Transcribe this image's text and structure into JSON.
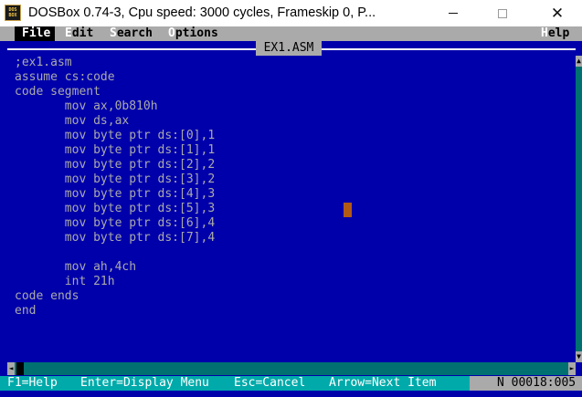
{
  "window": {
    "title": "DOSBox 0.74-3, Cpu speed:     3000 cycles, Frameskip  0, P...",
    "icon_top": "DOS",
    "icon_bottom": "BOX",
    "minimize_icon": "minimize-icon",
    "maximize_icon": "maximize-icon",
    "close_icon": "close-icon",
    "close_glyph": "✕"
  },
  "menubar": {
    "items": [
      {
        "hot": "F",
        "rest": "ile"
      },
      {
        "hot": "E",
        "rest": "dit"
      },
      {
        "hot": "S",
        "rest": "earch"
      },
      {
        "hot": "O",
        "rest": "ptions"
      },
      {
        "hot": "H",
        "rest": "elp"
      }
    ]
  },
  "editor": {
    "file_name": "EX1.ASM",
    "lines": [
      ";ex1.asm",
      "assume cs:code",
      "code segment",
      "       mov ax,0b810h",
      "       mov ds,ax",
      "       mov byte ptr ds:[0],1",
      "       mov byte ptr ds:[1],1",
      "       mov byte ptr ds:[2],2",
      "       mov byte ptr ds:[3],2",
      "       mov byte ptr ds:[4],3",
      "       mov byte ptr ds:[5],3",
      "       mov byte ptr ds:[6],4",
      "       mov byte ptr ds:[7],4",
      "",
      "       mov ah,4ch",
      "       int 21h",
      "code ends",
      "end"
    ]
  },
  "scrollbars": {
    "up": "▲",
    "down": "▼",
    "left": "◄",
    "right": "►"
  },
  "statusbar": {
    "f1": "F1=Help",
    "enter": "Enter=Display Menu",
    "esc": "Esc=Cancel",
    "arrow": "Arrow=Next Item",
    "position": "N 00018:005"
  },
  "colors": {
    "dos_blue": "#0000aa",
    "menu_gray": "#aaaaaa",
    "status_cyan": "#00aaaa",
    "cursor": "#b05a16"
  }
}
